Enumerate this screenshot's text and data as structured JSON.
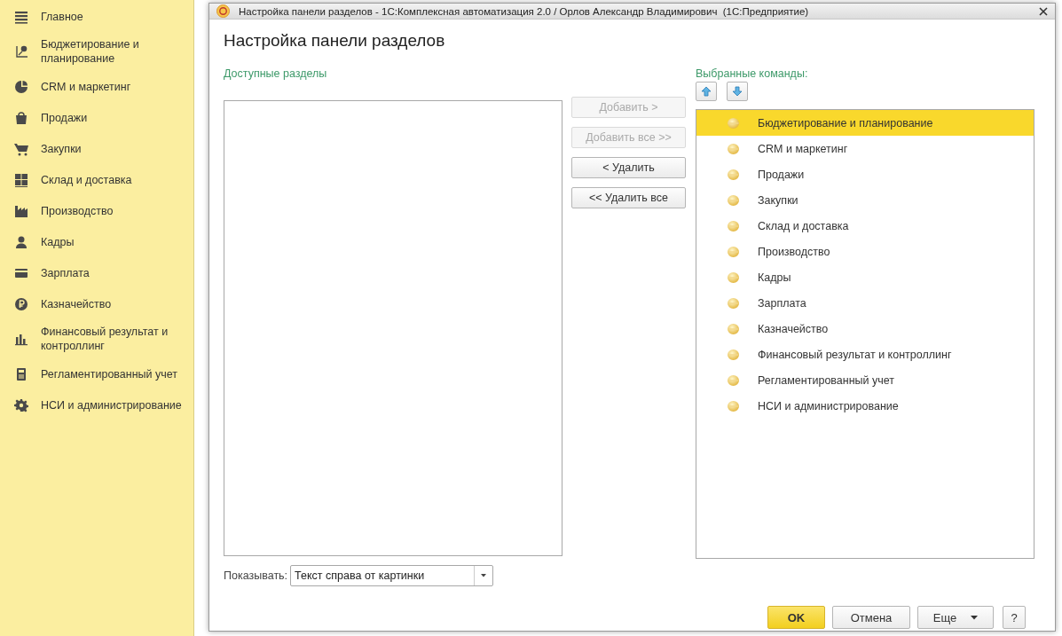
{
  "sidebar": {
    "items": [
      {
        "label": "Главное"
      },
      {
        "label": "Бюджетирование и планирование"
      },
      {
        "label": "CRM и маркетинг"
      },
      {
        "label": "Продажи"
      },
      {
        "label": "Закупки"
      },
      {
        "label": "Склад и доставка"
      },
      {
        "label": "Производство"
      },
      {
        "label": "Кадры"
      },
      {
        "label": "Зарплата"
      },
      {
        "label": "Казначейство"
      },
      {
        "label": "Финансовый результат и контроллинг"
      },
      {
        "label": "Регламентированный учет"
      },
      {
        "label": "НСИ и администрирование"
      }
    ]
  },
  "window": {
    "title": "Настройка панели разделов - 1С:Комплексная автоматизация 2.0 / Орлов Александр Владимирович  (1С:Предприятие)",
    "heading": "Настройка панели разделов"
  },
  "available": {
    "label": "Доступные разделы"
  },
  "move_buttons": [
    {
      "label": "Добавить >",
      "disabled": true
    },
    {
      "label": "Добавить все >>",
      "disabled": true
    },
    {
      "label": "< Удалить",
      "disabled": false
    },
    {
      "label": "<< Удалить все",
      "disabled": false
    }
  ],
  "chosen": {
    "label": "Выбранные команды:",
    "items": [
      {
        "label": "Бюджетирование и планирование",
        "selected": true
      },
      {
        "label": "CRM и маркетинг",
        "selected": false
      },
      {
        "label": "Продажи",
        "selected": false
      },
      {
        "label": "Закупки",
        "selected": false
      },
      {
        "label": "Склад и доставка",
        "selected": false
      },
      {
        "label": "Производство",
        "selected": false
      },
      {
        "label": "Кадры",
        "selected": false
      },
      {
        "label": "Зарплата",
        "selected": false
      },
      {
        "label": "Казначейство",
        "selected": false
      },
      {
        "label": "Финансовый результат и контроллинг",
        "selected": false
      },
      {
        "label": "Регламентированный учет",
        "selected": false
      },
      {
        "label": "НСИ и администрирование",
        "selected": false
      }
    ]
  },
  "show": {
    "label": "Показывать:",
    "value": "Текст справа от картинки"
  },
  "footer": {
    "ok": "OK",
    "cancel": "Отмена",
    "more": "Еще",
    "help": "?"
  }
}
